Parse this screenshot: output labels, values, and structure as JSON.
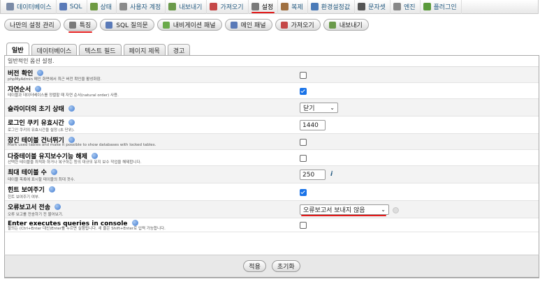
{
  "top_tabs": [
    {
      "label": "데이터베이스",
      "icon": "database-icon",
      "color": "#7a8aa6"
    },
    {
      "label": "SQL",
      "icon": "sql-icon",
      "color": "#5a7ab8"
    },
    {
      "label": "상태",
      "icon": "status-icon",
      "color": "#6e9a42"
    },
    {
      "label": "사용자 계정",
      "icon": "users-icon",
      "color": "#8a8a8a"
    },
    {
      "label": "내보내기",
      "icon": "export-icon",
      "color": "#6a9a4a"
    },
    {
      "label": "가져오기",
      "icon": "import-icon",
      "color": "#c54848"
    },
    {
      "label": "설정",
      "icon": "wrench-icon",
      "color": "#7a7a7a",
      "active": true
    },
    {
      "label": "복제",
      "icon": "replication-icon",
      "color": "#a07040"
    },
    {
      "label": "환경설정값",
      "icon": "variables-icon",
      "color": "#4a7ab8"
    },
    {
      "label": "문자셋",
      "icon": "charset-icon",
      "color": "#555555"
    },
    {
      "label": "엔진",
      "icon": "engine-icon",
      "color": "#888888"
    },
    {
      "label": "플러그인",
      "icon": "plugin-icon",
      "color": "#5a9a3a"
    }
  ],
  "sub_tabs": [
    {
      "label": "나만의 설정 관리",
      "icon": ""
    },
    {
      "label": "특징",
      "icon": "wrench-icon",
      "color": "#7a7a7a",
      "active": true
    },
    {
      "label": "SQL 질의문",
      "icon": "sql-icon",
      "color": "#5a7ab8"
    },
    {
      "label": "내비게이션 패널",
      "icon": "navigation-icon",
      "color": "#6aaa4a"
    },
    {
      "label": "메인 패널",
      "icon": "main-panel-icon",
      "color": "#5a7ab8"
    },
    {
      "label": "가져오기",
      "icon": "import-icon",
      "color": "#c54848"
    },
    {
      "label": "내보내기",
      "icon": "export-icon",
      "color": "#6a9a4a"
    }
  ],
  "form_tabs": [
    "일반",
    "데이터베이스",
    "텍스트 필드",
    "페이지 제목",
    "경고"
  ],
  "intro": "일반적인 옵션 설정.",
  "settings": [
    {
      "label": "버전 확인",
      "desc": "phpMyAdmin 메인 화면에서 최근 버전 확인을 활성화함.",
      "type": "checkbox",
      "checked": false
    },
    {
      "label": "자연순서",
      "desc": "테이블과 데이터베이스를 정렬할 때 자연 순서(natural order) 사용.",
      "type": "checkbox",
      "checked": true
    },
    {
      "label": "슬라이더의 초기 상태",
      "desc": "",
      "type": "select",
      "value": "닫기"
    },
    {
      "label": "로그인 쿠키 유효시간",
      "desc": "로그인 쿠키의 유효시간을 설정 (초 단위).",
      "type": "number",
      "value": "1440"
    },
    {
      "label": "잠긴 테이블 건너뛰기",
      "desc": "Mark used tables and make it possible to show databases with locked tables.",
      "type": "checkbox",
      "checked": false
    },
    {
      "label": "다중테이블 유지보수기능 해제",
      "desc": "선택한 테이블을 최적화 하거나 복구하는 등의 대규모 유지 보수 작업을 해제합니다.",
      "type": "checkbox",
      "checked": false
    },
    {
      "label": "최대 테이블 수",
      "desc": "테이블 목록에 표시할 테이블의 최대 갯수.",
      "type": "number",
      "value": "250",
      "extra": "i"
    },
    {
      "label": "힌트 보여주기",
      "desc": "힌트 보여주기 여부.",
      "type": "checkbox",
      "checked": true
    },
    {
      "label": "오류보고서 전송",
      "desc": "오류 보고를 전송하기 전 물어보기.",
      "type": "select",
      "value": "오류보고서 보내지 않음"
    },
    {
      "label": "Enter executes queries in console",
      "desc": "할의는 (Ctrl+Enter 대신)Enter를 누르면 실행됩니다. 새 줄은 Shift+Enter로 입력 가능합니다.",
      "type": "checkbox",
      "checked": false
    }
  ],
  "buttons": {
    "apply": "적용",
    "reset": "초기화"
  },
  "colors": {
    "accent_underline": "#e21b1b",
    "checkbox_on": "#1a73e8",
    "link": "#235a81"
  }
}
